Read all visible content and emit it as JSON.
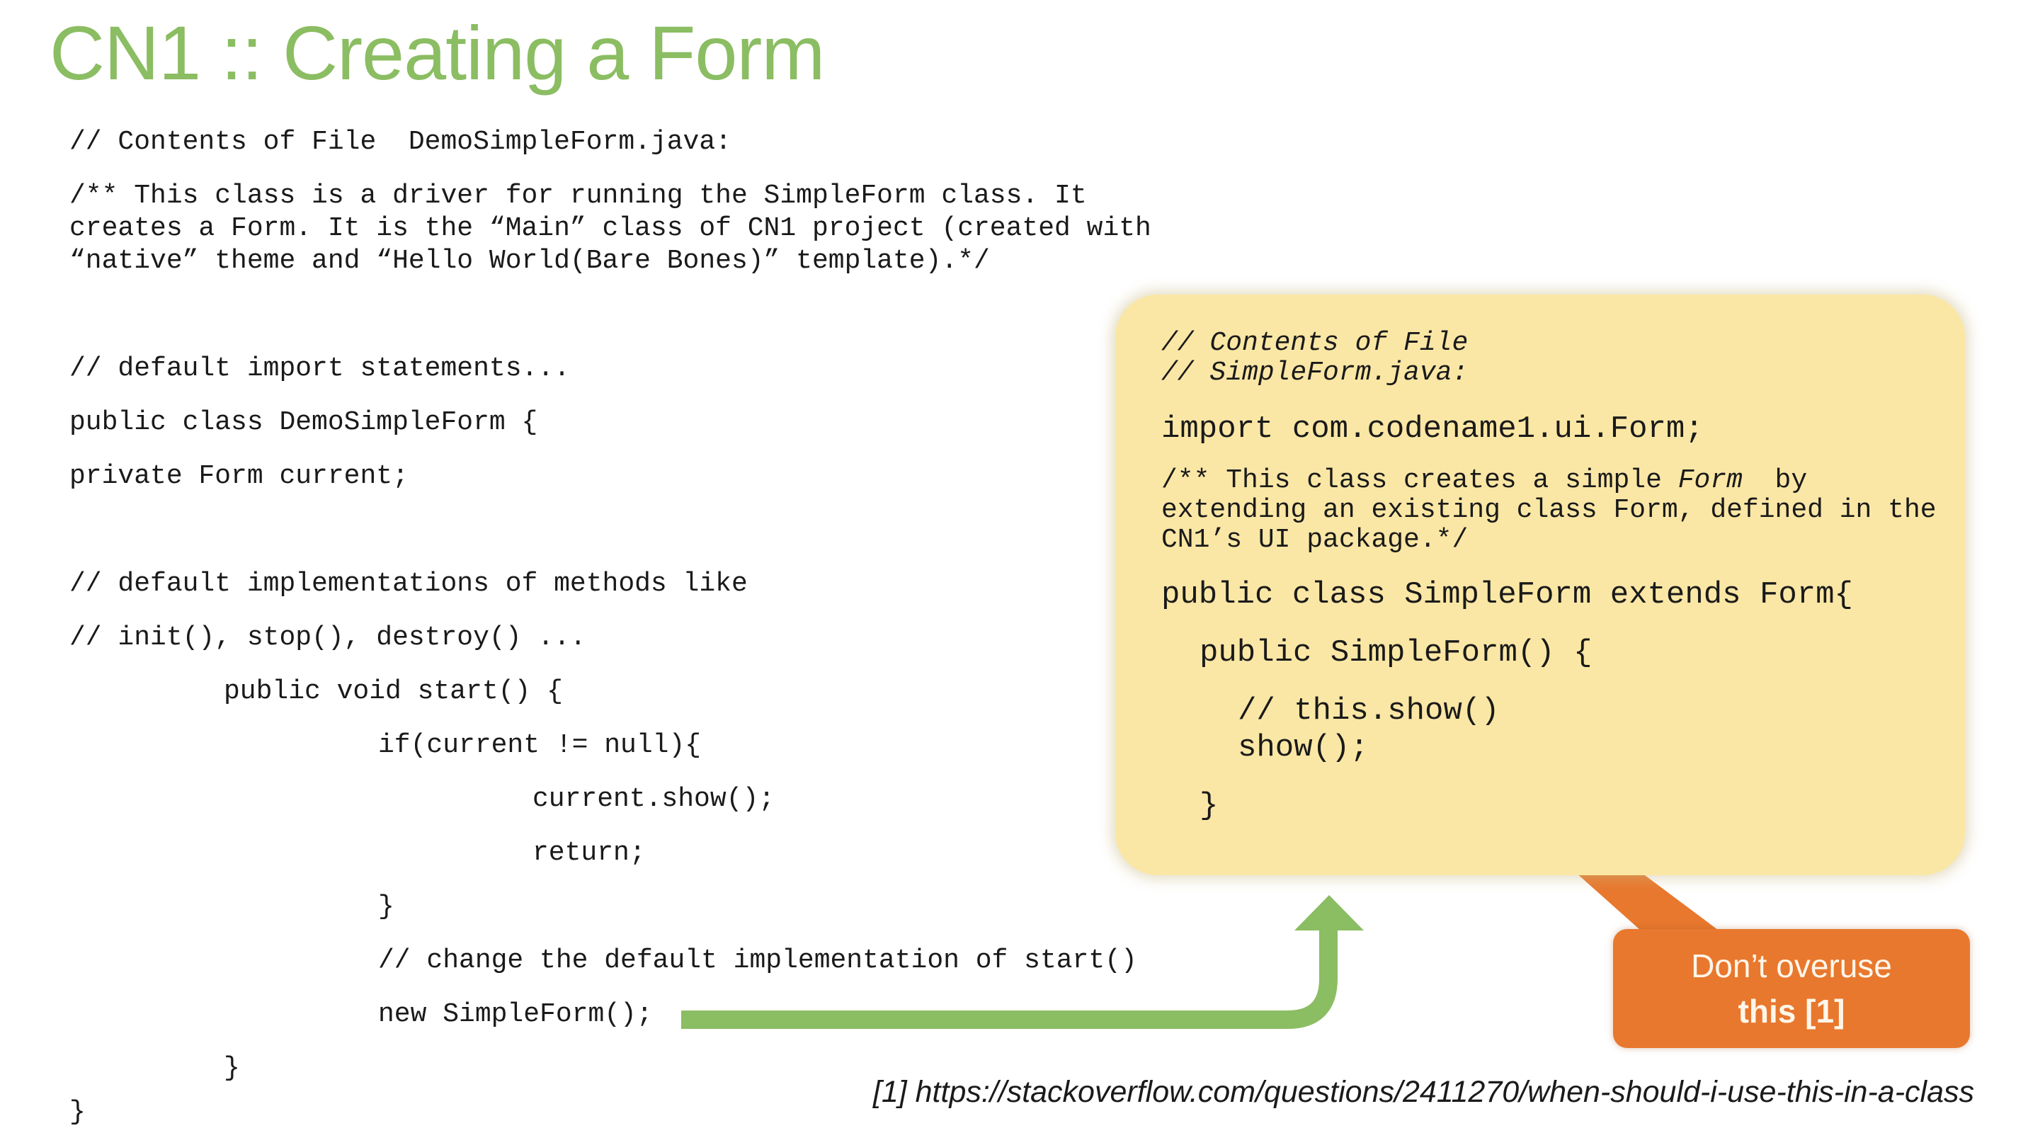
{
  "slide": {
    "title": "CN1 :: Creating a Form",
    "left_code": [
      "// Contents of File  DemoSimpleForm.java:",
      "/** This class is a driver for running the SimpleForm class. It",
      "creates a Form. It is the “Main” class of CN1 project (created with",
      "“native” theme and “Hello World(Bare Bones)” template).*/",
      "// default import statements...",
      "public class DemoSimpleForm {",
      "private Form current;",
      "// default implementations of methods like",
      "// init(), stop(), destroy() ...",
      "public void start() {",
      "if(current != null){",
      "current.show();",
      "return;",
      "}",
      "// change the default implementation of start()",
      "new SimpleForm();",
      "}",
      "}"
    ],
    "bubble": {
      "comment_1": "// Contents of File",
      "comment_2": "// SimpleForm.java:",
      "import_line": "import com.codename1.ui.Form;",
      "doc_1_pre": "/** This class creates a simple ",
      "doc_1_em": "Form",
      "doc_1_post": "  by",
      "doc_2": "extending an existing class Form, defined in the",
      "doc_3": "CN1’s UI package.*/",
      "class_decl": "public class SimpleForm extends Form{",
      "ctor_decl": "public SimpleForm() {",
      "this_comment": "// this.show()",
      "show_call": "show();",
      "close_brace": "}"
    },
    "callout": {
      "line1": "Don’t overuse",
      "line2": "this [1]"
    },
    "reference": "[1] https://stackoverflow.com/questions/2411270/when-should-i-use-this-in-a-class",
    "colors": {
      "title": "#8bbd62",
      "bubble": "#fbe7a5",
      "callout": "#e8782e",
      "arrow": "#8bbd62"
    }
  }
}
